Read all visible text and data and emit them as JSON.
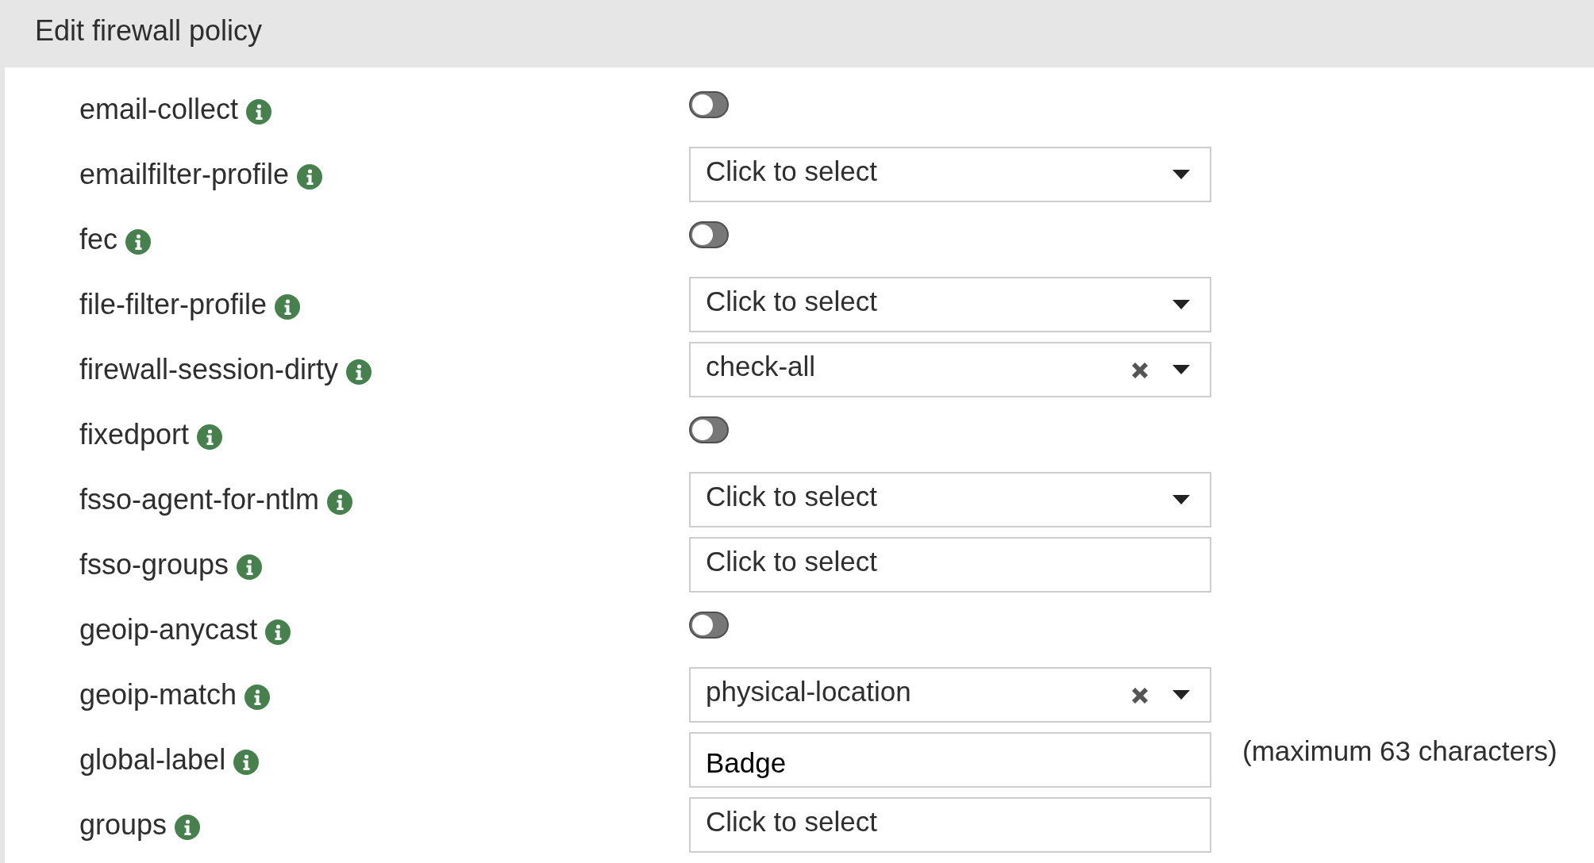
{
  "header": {
    "title": "Edit firewall policy"
  },
  "fields": [
    {
      "label": "email-collect",
      "kind": "toggle",
      "on": false
    },
    {
      "label": "emailfilter-profile",
      "kind": "select",
      "placeholder": "Click to select"
    },
    {
      "label": "fec",
      "kind": "toggle",
      "on": false
    },
    {
      "label": "file-filter-profile",
      "kind": "select",
      "placeholder": "Click to select"
    },
    {
      "label": "firewall-session-dirty",
      "kind": "select",
      "value": "check-all"
    },
    {
      "label": "fixedport",
      "kind": "toggle",
      "on": false
    },
    {
      "label": "fsso-agent-for-ntlm",
      "kind": "select",
      "placeholder": "Click to select"
    },
    {
      "label": "fsso-groups",
      "kind": "multiselect",
      "placeholder": "Click to select"
    },
    {
      "label": "geoip-anycast",
      "kind": "toggle",
      "on": false
    },
    {
      "label": "geoip-match",
      "kind": "select",
      "value": "physical-location"
    },
    {
      "label": "global-label",
      "kind": "text",
      "value": "Badge",
      "note": "(maximum 63 characters)"
    },
    {
      "label": "groups",
      "kind": "multiselect",
      "placeholder": "Click to select"
    }
  ]
}
